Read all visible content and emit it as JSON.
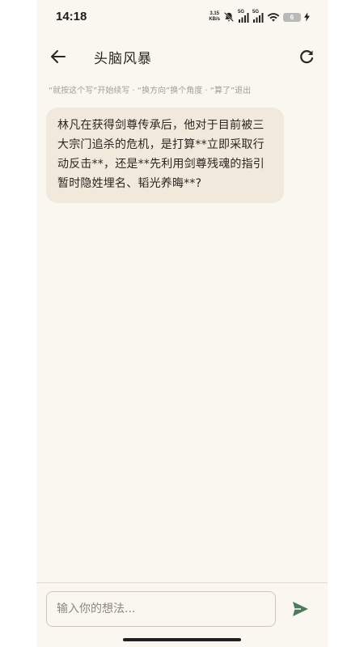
{
  "status_bar": {
    "time": "14:18",
    "net_speed_value": "3.15",
    "net_speed_unit": "KB/s",
    "sim1_tag": "5G",
    "sim2_tag": "5G",
    "battery_level": "6"
  },
  "header": {
    "title": "头脑风暴"
  },
  "hint_text": "“就按这个写”开始续写 · “换方向”换个角度 · “算了”退出",
  "messages": [
    {
      "role": "assistant",
      "text": "林凡在获得剑尊传承后，他对于目前被三大宗门追杀的危机，是打算**立即采取行动反击**，还是**先利用剑尊残魂的指引暂时隐姓埋名、韬光养晦**?"
    }
  ],
  "composer": {
    "placeholder": "输入你的想法...",
    "value": ""
  },
  "icons": {
    "back": "arrow-left-icon",
    "refresh": "refresh-icon",
    "send": "send-icon",
    "mute": "bell-off-icon",
    "wifi": "wifi-icon",
    "charging": "bolt-icon"
  },
  "colors": {
    "background": "#faf7f1",
    "bubble": "#f1e9dc",
    "send_accent": "#4f7a5a",
    "hint": "#a39e95"
  }
}
